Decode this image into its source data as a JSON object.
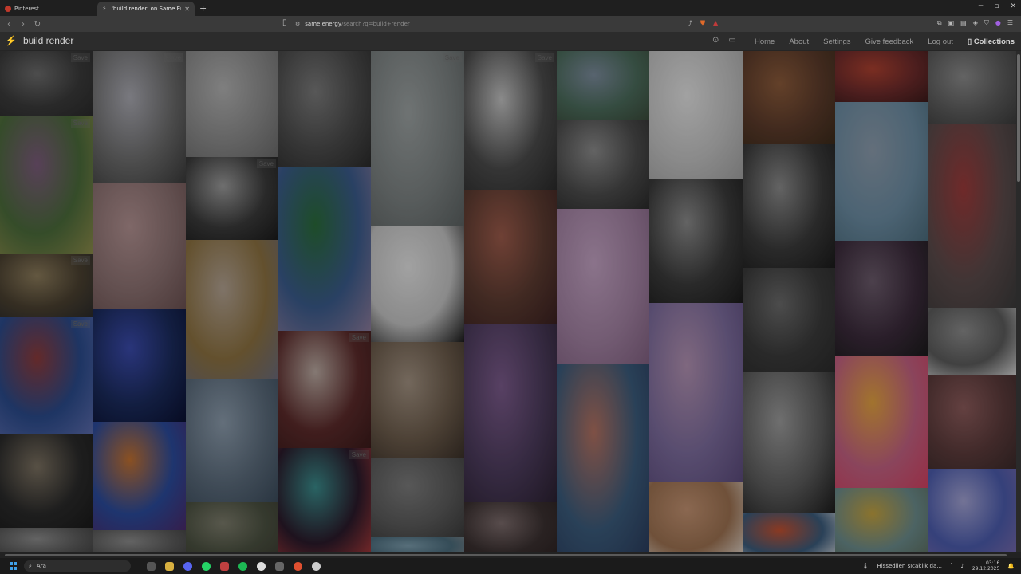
{
  "browser": {
    "tabs": [
      {
        "title": "Pinterest",
        "active": false
      },
      {
        "title": "'build render' on Same Energy",
        "active": true
      }
    ],
    "new_tab_icon": "plus-icon",
    "window_controls": [
      "minimize-icon",
      "maximize-icon",
      "close-icon"
    ],
    "url_host": "same.energy",
    "url_path": "/search?q=build+render"
  },
  "app": {
    "title": "build render",
    "logo_icon": "lightning-icon",
    "nav": [
      "Home",
      "About",
      "Settings",
      "Give feedback",
      "Log out",
      "Collections"
    ],
    "save_label": "Save",
    "accent": "#b03030"
  },
  "grid": {
    "tiles": [
      {
        "name": "stormy-clouds",
        "colors": [
          "#3a3a3a",
          "#6b6b6b",
          "#2a2a2a"
        ],
        "save": true
      },
      {
        "name": "desert-cactus",
        "colors": [
          "#4a6a3a",
          "#7a5a7a",
          "#8a8a4a"
        ],
        "save": true
      },
      {
        "name": "office-interior",
        "colors": [
          "#4a4030",
          "#8a7a5a",
          "#2a2a2a"
        ],
        "save": true
      },
      {
        "name": "abstract-head",
        "colors": [
          "#2a4a8a",
          "#8a3a3a",
          "#5a6aaa"
        ],
        "save": true
      },
      {
        "name": "smoke-figure",
        "colors": [
          "#2a2a2a",
          "#7a7060",
          "#1a1a1a"
        ],
        "save": false
      },
      {
        "name": "last-col1",
        "colors": [
          "#5a5a5a",
          "#8a8a8a",
          "#3a3a3a"
        ],
        "save": false
      },
      {
        "name": "statues-dome",
        "colors": [
          "#6a6a6a",
          "#a8a8b0",
          "#3a3a3a"
        ],
        "save": true
      },
      {
        "name": "sketch-portrait",
        "colors": [
          "#8a7070",
          "#b09090",
          "#6a5050"
        ],
        "save": false
      },
      {
        "name": "blue-skeleton",
        "colors": [
          "#1a2a5a",
          "#3a4aaa",
          "#0a1030"
        ],
        "save": false
      },
      {
        "name": "psychedelic-art",
        "colors": [
          "#2a4a9a",
          "#c07030",
          "#4a2a6a"
        ],
        "save": false
      },
      {
        "name": "col2-bottom",
        "colors": [
          "#5a5a5a",
          "#8a8a8a",
          "#3a3a3a"
        ],
        "save": false
      },
      {
        "name": "umbrella-bridge",
        "colors": [
          "#8a8a8a",
          "#b0b0b0",
          "#6a6a6a"
        ],
        "save": false
      },
      {
        "name": "protest-bw",
        "colors": [
          "#3a3a3a",
          "#9a9a9a",
          "#1a1a1a"
        ],
        "save": true
      },
      {
        "name": "sunset-fog",
        "colors": [
          "#8a7040",
          "#b0a090",
          "#6a6a7a"
        ],
        "save": false
      },
      {
        "name": "pebbles-blue",
        "colors": [
          "#5a6a7a",
          "#8a9aaa",
          "#3a4a5a"
        ],
        "save": false
      },
      {
        "name": "moss-rock",
        "colors": [
          "#4a5040",
          "#7a7a6a",
          "#3a3a30"
        ],
        "save": false
      },
      {
        "name": "highway-city",
        "colors": [
          "#4a4a4a",
          "#7a7a7a",
          "#2a2a2a"
        ],
        "save": false
      },
      {
        "name": "city-skyline",
        "colors": [
          "#3a5a8a",
          "#2a6a3a",
          "#8a7a9a"
        ],
        "save": false
      },
      {
        "name": "leaf-pattern",
        "colors": [
          "#5a2a2a",
          "#b8a8a0",
          "#3a1a1a"
        ],
        "save": true
      },
      {
        "name": "neon-street",
        "colors": [
          "#2a1a2a",
          "#3a8a8a",
          "#aa3a3a"
        ],
        "save": true
      },
      {
        "name": "foggy-tower",
        "colors": [
          "#7a8080",
          "#9aa0a0",
          "#5a6060"
        ],
        "save": true
      },
      {
        "name": "silhouette-white",
        "colors": [
          "#c0c0c0",
          "#e0e0e0",
          "#1a1a1a"
        ],
        "save": false
      },
      {
        "name": "arch-church",
        "colors": [
          "#6a5a4a",
          "#a09080",
          "#3a3028"
        ],
        "save": false
      },
      {
        "name": "ruined-tower",
        "colors": [
          "#5a5a5a",
          "#7a7a7a",
          "#3a3a3a"
        ],
        "save": false
      },
      {
        "name": "lake-blue",
        "colors": [
          "#4a6a7a",
          "#7a9aaa",
          "#8a8a8a"
        ],
        "save": false
      },
      {
        "name": "lake-splash",
        "colors": [
          "#4a4a4a",
          "#c0c0c0",
          "#2a2a2a"
        ],
        "save": true
      },
      {
        "name": "painting-sofa",
        "colors": [
          "#5a3a30",
          "#9a5a4a",
          "#3a2020"
        ],
        "save": false
      },
      {
        "name": "purple-curtain",
        "colors": [
          "#4a3a5a",
          "#7a5a8a",
          "#2a2030"
        ],
        "save": false
      },
      {
        "name": "beaded-curtain",
        "colors": [
          "#3a3030",
          "#7a6a6a",
          "#2a2020"
        ],
        "save": false
      },
      {
        "name": "tree-sky",
        "colors": [
          "#4a6a5a",
          "#7a8a9a",
          "#3a4a3a"
        ],
        "save": false
      },
      {
        "name": "bw-hands",
        "colors": [
          "#4a4a4a",
          "#8a8a8a",
          "#2a2a2a"
        ],
        "save": false
      },
      {
        "name": "pink-blur",
        "colors": [
          "#a080a0",
          "#c0a0c0",
          "#806080"
        ],
        "save": false
      },
      {
        "name": "ocean-sunset",
        "colors": [
          "#3a5a7a",
          "#b07060",
          "#2a3a5a"
        ],
        "save": false
      },
      {
        "name": "line-drawing",
        "colors": [
          "#c0c0c0",
          "#e0e0e0",
          "#a0a0a0"
        ],
        "save": false
      },
      {
        "name": "bw-child",
        "colors": [
          "#3a3a3a",
          "#8a8a8a",
          "#1a1a1a"
        ],
        "save": false
      },
      {
        "name": "floral-purple",
        "colors": [
          "#7a6a9a",
          "#b090b0",
          "#5a4a7a"
        ],
        "save": false
      },
      {
        "name": "tan-dress",
        "colors": [
          "#9a7050",
          "#c09070",
          "#e0d8d0"
        ],
        "save": false
      },
      {
        "name": "autumn-street",
        "colors": [
          "#5a3a2a",
          "#8a5a3a",
          "#3a2a1a"
        ],
        "save": false
      },
      {
        "name": "bw-window",
        "colors": [
          "#3a3a3a",
          "#8a8a8a",
          "#1a1a1a"
        ],
        "save": false
      },
      {
        "name": "bw-tree",
        "colors": [
          "#3a3a3a",
          "#6a6a6a",
          "#2a2a2a"
        ],
        "save": false
      },
      {
        "name": "shadow-camera",
        "colors": [
          "#5a5a5a",
          "#9a9a9a",
          "#1a1a1a"
        ],
        "save": false
      },
      {
        "name": "koi-mosaic",
        "colors": [
          "#3a5a7a",
          "#c05030",
          "#e0e0e0"
        ],
        "save": false
      },
      {
        "name": "red-flowers",
        "colors": [
          "#6a2a2a",
          "#aa4030",
          "#3a1a1a"
        ],
        "save": false
      },
      {
        "name": "zeppelin-sky",
        "colors": [
          "#6a8aa0",
          "#8a9aaa",
          "#4a6a7a"
        ],
        "save": false
      },
      {
        "name": "dark-figure",
        "colors": [
          "#3a2a3a",
          "#6a5a6a",
          "#1a1a1a"
        ],
        "save": false
      },
      {
        "name": "pop-art-woman",
        "colors": [
          "#c06080",
          "#e0a040",
          "#d04060"
        ],
        "save": false
      },
      {
        "name": "yellow-car-collage",
        "colors": [
          "#6a8a8a",
          "#c0a040",
          "#5a6a5a"
        ],
        "save": false
      },
      {
        "name": "rooftop-bw",
        "colors": [
          "#5a5a5a",
          "#8a8a8a",
          "#3a3a3a"
        ],
        "save": false
      },
      {
        "name": "red-interior",
        "colors": [
          "#5a4a4a",
          "#9a3a3a",
          "#3a3a3a"
        ],
        "save": false
      },
      {
        "name": "grey-top-model",
        "colors": [
          "#5a5a5a",
          "#8a8a8a",
          "#d0d0d0"
        ],
        "save": false
      },
      {
        "name": "bicycles",
        "colors": [
          "#5a3a3a",
          "#8a5a5a",
          "#3a2a2a"
        ],
        "save": false
      },
      {
        "name": "cloud-pastel",
        "colors": [
          "#4a5aaa",
          "#a0a0d0",
          "#7a6aaa"
        ],
        "save": false
      },
      {
        "name": "last-col-bottom",
        "colors": [
          "#4a5a6a",
          "#8a8a8a",
          "#2a3a4a"
        ],
        "save": false
      }
    ]
  },
  "taskbar": {
    "search_placeholder": "Ara",
    "search_icon": "search-icon",
    "notification_text": "Hissedilen sıcaklık da...",
    "time": "03:16",
    "date": "29.12.2025"
  }
}
